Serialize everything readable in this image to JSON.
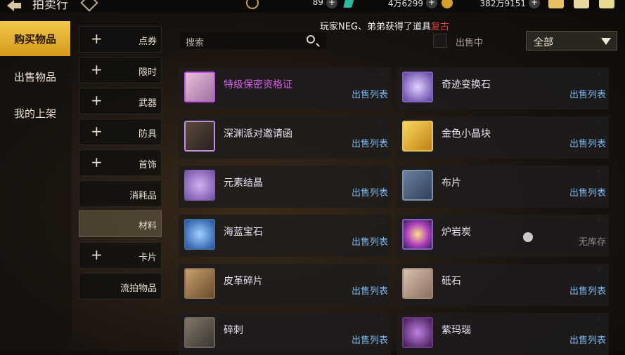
{
  "header": {
    "title": "拍卖行",
    "currency1": "89",
    "currency2": "4万6299",
    "currency3": "382万9151"
  },
  "nav": {
    "items": [
      {
        "label": "购买物品"
      },
      {
        "label": "出售物品"
      },
      {
        "label": "我的上架"
      }
    ]
  },
  "categories": [
    {
      "label": "点券",
      "plus": "+"
    },
    {
      "label": "限时",
      "plus": "+"
    },
    {
      "label": "武器",
      "plus": "+"
    },
    {
      "label": "防具",
      "plus": "+"
    },
    {
      "label": "首饰",
      "plus": "+"
    },
    {
      "label": "消耗品"
    },
    {
      "label": "材料"
    },
    {
      "label": "卡片",
      "plus": "+"
    },
    {
      "label": "流拍物品"
    }
  ],
  "search": {
    "placeholder": "搜索"
  },
  "notice": {
    "prefix": "玩家NEG、弟弟获得了道具",
    "highlight": "复古"
  },
  "filter": {
    "on_sale_label": "出售中",
    "selected": "全部"
  },
  "items": [
    {
      "name": "特级保密资格证",
      "status": "出售列表"
    },
    {
      "name": "奇迹变换石",
      "status": "出售列表"
    },
    {
      "name": "深渊派对邀请函",
      "status": "出售列表"
    },
    {
      "name": "金色小晶块",
      "status": "出售列表"
    },
    {
      "name": "元素结晶",
      "status": "出售列表"
    },
    {
      "name": "布片",
      "status": "出售列表"
    },
    {
      "name": "海蓝宝石",
      "status": "出售列表"
    },
    {
      "name": "炉岩炭",
      "status": "无库存"
    },
    {
      "name": "皮革碎片",
      "status": "出售列表"
    },
    {
      "name": "砥石",
      "status": "出售列表"
    },
    {
      "name": "碎刺",
      "status": "出售列表"
    },
    {
      "name": "紫玛瑙",
      "status": "出售列表"
    }
  ],
  "icons": {
    "back": "back-arrow-icon",
    "help": "help-diamond-icon",
    "coin": "coin-icon",
    "gem": "gem-icon",
    "gold": "gold-coin-icon",
    "mail": "mail-icon",
    "chat": "chat-icon",
    "box": "box-icon",
    "star": "star-icon",
    "search": "search-icon",
    "dropdown": "chevron-down-icon"
  },
  "colors": {
    "accent_gold": "#e8b030",
    "link_blue": "#7ab8f0",
    "highlight_purple": "#d060e8",
    "notice_red": "#e04040"
  }
}
